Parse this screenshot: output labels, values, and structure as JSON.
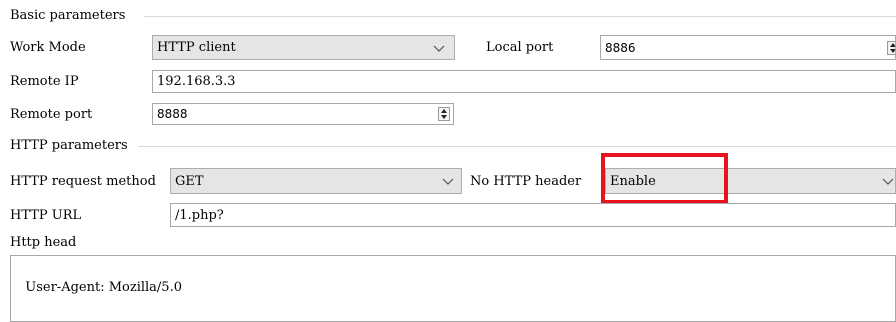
{
  "basic": {
    "title": "Basic parameters",
    "work_mode_label": "Work Mode",
    "work_mode_value": "HTTP client",
    "local_port_label": "Local port",
    "local_port_value": "8886",
    "remote_ip_label": "Remote IP",
    "remote_ip_value": "192.168.3.3",
    "remote_port_label": "Remote port",
    "remote_port_value": "8888"
  },
  "http": {
    "title": "HTTP parameters",
    "method_label": "HTTP request method",
    "method_value": "GET",
    "no_header_label": "No HTTP header",
    "no_header_value": "Enable",
    "url_label": "HTTP URL",
    "url_value": "/1.php?",
    "head_label": "Http head",
    "head_value": "User-Agent: Mozilla/5.0"
  },
  "colors": {
    "highlight": "#e8141d",
    "combo_bg": "#e5e5e5",
    "border": "#a8a8a8"
  },
  "icons": [
    "chevron-down-icon",
    "spin-up-icon",
    "spin-down-icon"
  ]
}
